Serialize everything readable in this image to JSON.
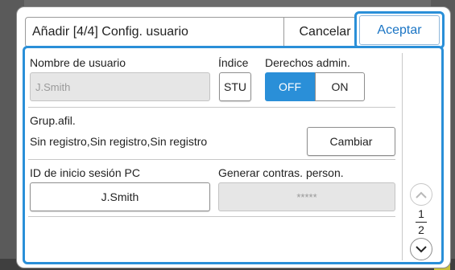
{
  "dialog": {
    "title": "Añadir [4/4] Config. usuario",
    "cancel_label": "Cancelar",
    "accept_label": "Aceptar"
  },
  "form": {
    "username_label": "Nombre de usuario",
    "username_value": "J.Smith",
    "index_label": "Índice",
    "index_value": "STU",
    "admin_rights_label": "Derechos admin.",
    "admin_off_label": "OFF",
    "admin_on_label": "ON",
    "admin_selected": "OFF",
    "group_label": "Grup.afil.",
    "group_value": "Sin registro,Sin registro,Sin registro",
    "group_change_label": "Cambiar",
    "pc_login_label": "ID de inicio sesión PC",
    "pc_login_value": "J.Smith",
    "gen_password_label": "Generar contras. person.",
    "gen_password_value": "*****"
  },
  "pagination": {
    "current": "1",
    "total": "2"
  },
  "colors": {
    "accent": "#2a8fd8",
    "accept_text": "#1a74c4"
  },
  "icons": {
    "scroll_up": "chevron-up-icon",
    "scroll_down": "chevron-down-icon"
  }
}
